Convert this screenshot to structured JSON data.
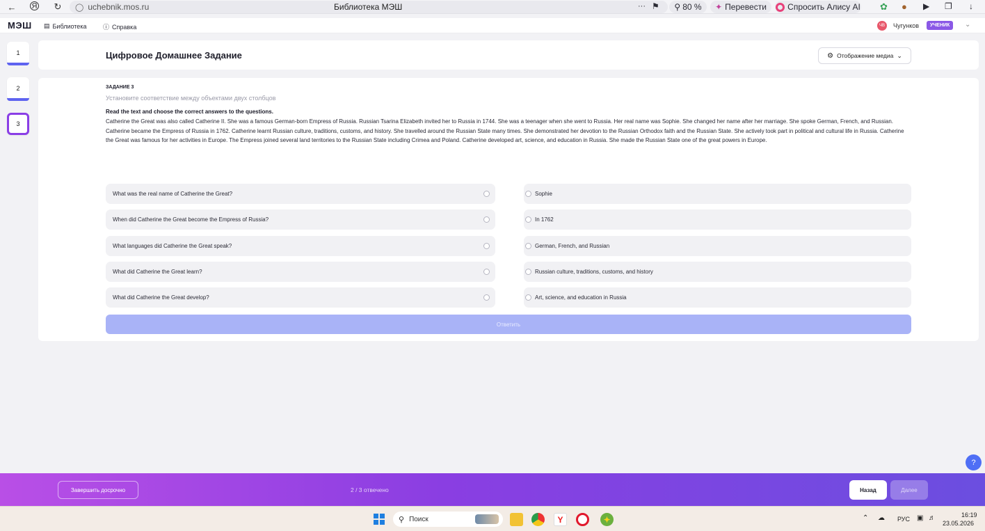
{
  "browser": {
    "url": "uchebnik.mos.ru",
    "tab_title": "Библиотека МЭШ",
    "zoom": "80 %",
    "translate_label": "Перевести",
    "alice_label": "Спросить Алису AI"
  },
  "header": {
    "logo": "МЭШ",
    "nav_library": "Библиотека",
    "nav_help": "Справка",
    "user_initials": "ЧВ",
    "user_name": "Чугунков",
    "role_badge": "УЧЕНИК"
  },
  "sidebar": {
    "tabs": [
      {
        "label": "1"
      },
      {
        "label": "2"
      },
      {
        "label": "3"
      }
    ]
  },
  "page": {
    "title": "Цифровое Домашнее Задание",
    "media_button": "Отображение медиа"
  },
  "task": {
    "label": "ЗАДАНИЕ 3",
    "subtitle": "Установите соответствие между объектами двух столбцов",
    "instructions": "Read the text and choose the correct answers to the questions.",
    "passage": "Catherine the Great was also called Catherine II. She was a famous German-born Empress of Russia. Russian Tsarina Elizabeth invited her to Russia in 1744. She was a teenager when she went to Russia. Her real name was Sophie. She changed her name after her marriage. She spoke German, French, and Russian. Catherine became the Empress of Russia in 1762. Catherine learnt Russian culture, traditions, customs, and history. She travelled around the Russian State many times. She demonstrated her devotion to the Russian Orthodox faith and the Russian State. She actively took part in political and cultural life in Russia. Catherine the Great was famous for her activities in Europe. The Empress joined several land territories to the Russian State including Crimea and Poland. Catherine developed art, science, and education in Russia. She made the Russian State one of the great powers in Europe.",
    "questions": [
      "What was the real name of Catherine the Great?",
      "When did Catherine the Great become the Empress of Russia?",
      "What languages did Catherine the Great speak?",
      "What did Catherine the Great learn?",
      "What did Catherine the Great develop?"
    ],
    "answers": [
      "Sophie",
      "In 1762",
      "German, French, and Russian",
      "Russian culture, traditions, customs, and history",
      "Art, science, and education in Russia"
    ],
    "submit_label": "Ответить"
  },
  "help_fab": "?",
  "footer": {
    "finish_label": "Завершить досрочно",
    "progress": "2 / 3 отвечено",
    "back_label": "Назад",
    "next_label": "Далее"
  },
  "taskbar": {
    "search_placeholder": "Поиск",
    "language": "РУС",
    "time": "16:19",
    "date": "23.05.2026"
  }
}
